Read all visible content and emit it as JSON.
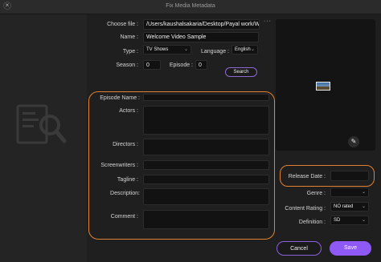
{
  "window": {
    "title": "Fix Media Metadata",
    "close_glyph": "×"
  },
  "form": {
    "choose_file_label": "Choose file :",
    "choose_file_value": "/Users/kaushalsakaria/Desktop/Payal work/Wi",
    "browse_label": "···",
    "name_label": "Name :",
    "name_value": "Welcome Video Sample",
    "type_label": "Type :",
    "type_value": "TV Shows",
    "language_label": "Language :",
    "language_value": "English",
    "season_label": "Season :",
    "season_value": "0",
    "episode_label": "Episode :",
    "episode_value": "0",
    "search_label": "Search",
    "episode_name_label": "Episode Name :",
    "actors_label": "Actors :",
    "directors_label": "Directors :",
    "screenwriters_label": "Screenwriters :",
    "tagline_label": "Tagline :",
    "description_label": "Description:",
    "comment_label": "Comment :"
  },
  "side": {
    "release_date_label": "Release Date :",
    "genre_label": "Genre :",
    "content_rating_label": "Content Rating :",
    "content_rating_value": "NO rated",
    "definition_label": "Definition :",
    "definition_value": "SD"
  },
  "buttons": {
    "cancel": "Cancel",
    "save": "Save"
  },
  "icons": {
    "close": "close-icon",
    "chevron": "chevron-down-icon",
    "edit": "edit-icon",
    "document": "document-search-icon"
  },
  "colors": {
    "accent_purple": "#8e59f5",
    "highlight_orange": "#e0822f"
  }
}
